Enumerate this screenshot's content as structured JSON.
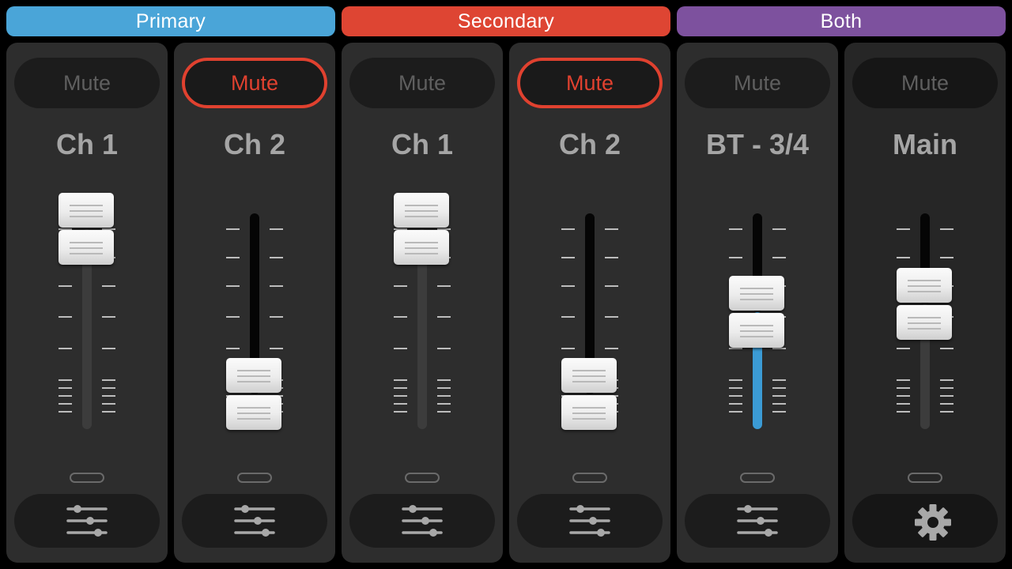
{
  "groups": {
    "primary": {
      "label": "Primary",
      "color": "#4aa5d8"
    },
    "secondary": {
      "label": "Secondary",
      "color": "#de4533"
    },
    "both": {
      "label": "Both",
      "color": "#7d519e"
    }
  },
  "colors": {
    "mute_active": "#e0412f",
    "level_fill": "#3b9bd5"
  },
  "strips": [
    {
      "group": "Primary",
      "name": "Ch 1",
      "mute_label": "Mute",
      "muted": false,
      "fader_level": 1.0,
      "footer_icon": "sliders-icon"
    },
    {
      "group": "Primary",
      "name": "Ch 2",
      "mute_label": "Mute",
      "muted": true,
      "fader_level": 0.12,
      "footer_icon": "sliders-icon"
    },
    {
      "group": "Secondary",
      "name": "Ch 1",
      "mute_label": "Mute",
      "muted": false,
      "fader_level": 1.0,
      "footer_icon": "sliders-icon"
    },
    {
      "group": "Secondary",
      "name": "Ch 2",
      "mute_label": "Mute",
      "muted": true,
      "fader_level": 0.12,
      "footer_icon": "sliders-icon"
    },
    {
      "group": "Both",
      "name": "BT - 3/4",
      "mute_label": "Mute",
      "muted": false,
      "fader_level": 0.56,
      "footer_icon": "sliders-icon"
    },
    {
      "group": "Both",
      "name": "Main",
      "mute_label": "Mute",
      "muted": false,
      "fader_level": 0.6,
      "footer_icon": "gear-icon"
    }
  ]
}
